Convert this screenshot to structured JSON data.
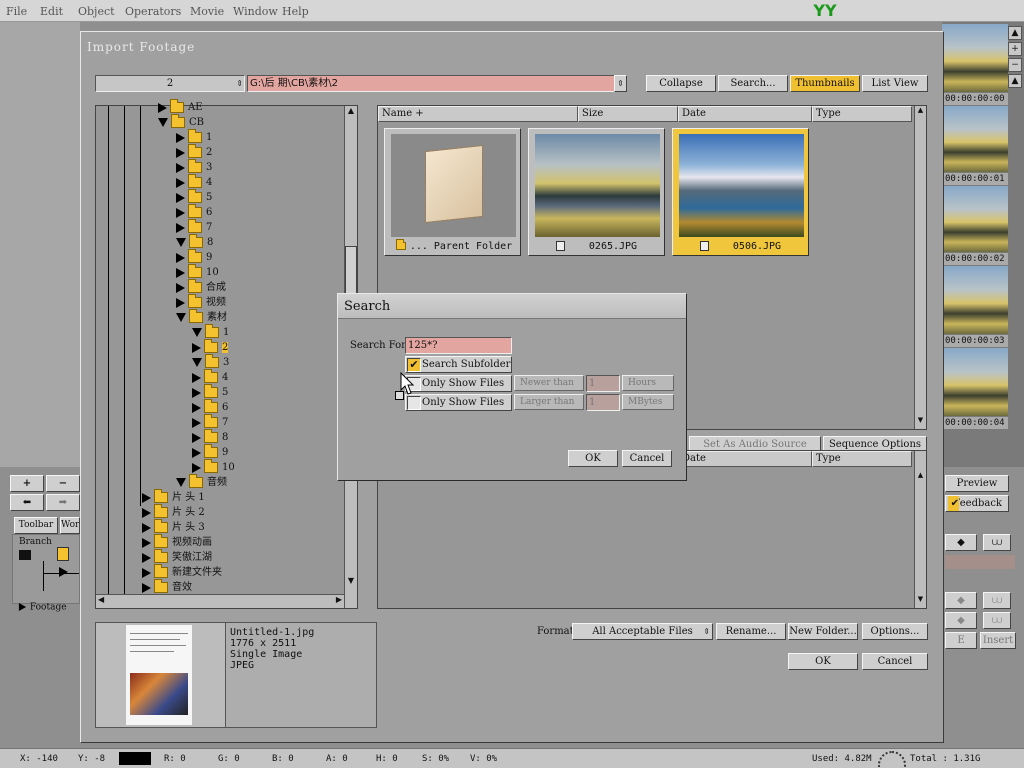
{
  "menubar": [
    "File",
    "Edit",
    "Object",
    "Operators",
    "Movie",
    "Window",
    "Help"
  ],
  "logo_text": "YY",
  "timecodes": [
    "00:00:00:00",
    "00:00:00:01",
    "00:00:00:02",
    "00:00:00:03",
    "00:00:00:04"
  ],
  "right_buttons": [
    "Preview",
    "Feedback"
  ],
  "left_panel": {
    "plus": "+",
    "minus": "−",
    "tab_toolbar": "Toolbar",
    "tab_wo": "Wor",
    "branch": "Branch",
    "footage": "Footage"
  },
  "dialog": {
    "title": "Import Footage",
    "folder_select": "2",
    "path": "G:\\后 期\\CB\\素材\\2",
    "buttons": {
      "collapse": "Collapse",
      "search": "Search...",
      "thumbnails": "Thumbnails",
      "list_view": "List View"
    },
    "columns": [
      "Name +",
      "Size",
      "Date",
      "Type"
    ],
    "thumbs": [
      {
        "caption": "... Parent Folder"
      },
      {
        "caption": "0265.JPG"
      },
      {
        "caption": "0506.JPG"
      }
    ],
    "seq_tabs": {
      "audio": "Set As Audio Source",
      "seq": "Sequence Options"
    },
    "seq_columns": [
      "Date",
      "Type"
    ],
    "format_label": "Format",
    "format_value": "All Acceptable Files",
    "rename": "Rename...",
    "new_folder": "New Folder...",
    "options": "Options...",
    "ok": "OK",
    "cancel": "Cancel",
    "info": {
      "name": "Untitled-1.jpg",
      "dims": "1776 x 2511",
      "kind": "Single Image",
      "format": "JPEG"
    }
  },
  "tree": [
    {
      "label": "AE",
      "depth": 0,
      "open": false
    },
    {
      "label": "CB",
      "depth": 0,
      "open": true
    },
    {
      "label": "1",
      "depth": 1
    },
    {
      "label": "2",
      "depth": 1
    },
    {
      "label": "3",
      "depth": 1
    },
    {
      "label": "4",
      "depth": 1
    },
    {
      "label": "5",
      "depth": 1
    },
    {
      "label": "6",
      "depth": 1
    },
    {
      "label": "7",
      "depth": 1
    },
    {
      "label": "8",
      "depth": 1,
      "open": true
    },
    {
      "label": "9",
      "depth": 1
    },
    {
      "label": "10",
      "depth": 1
    },
    {
      "label": "合成",
      "depth": 1
    },
    {
      "label": "视频",
      "depth": 1
    },
    {
      "label": "素材",
      "depth": 1,
      "open": true
    },
    {
      "label": "1",
      "depth": 2,
      "open": true
    },
    {
      "label": "2",
      "depth": 2,
      "selected": true
    },
    {
      "label": "3",
      "depth": 2,
      "open": true
    },
    {
      "label": "4",
      "depth": 2
    },
    {
      "label": "5",
      "depth": 2
    },
    {
      "label": "6",
      "depth": 2
    },
    {
      "label": "7",
      "depth": 2
    },
    {
      "label": "8",
      "depth": 2
    },
    {
      "label": "9",
      "depth": 2
    },
    {
      "label": "10",
      "depth": 2
    },
    {
      "label": "音频",
      "depth": 1,
      "open": true
    },
    {
      "label": "片 头 1",
      "depth": -1
    },
    {
      "label": "片 头 2",
      "depth": -1
    },
    {
      "label": "片 头 3",
      "depth": -1
    },
    {
      "label": "视频动画",
      "depth": -1
    },
    {
      "label": "笑傲江湖",
      "depth": -1
    },
    {
      "label": "新建文件夹",
      "depth": -1
    },
    {
      "label": "音效",
      "depth": -1
    }
  ],
  "search": {
    "title": "Search",
    "search_for_label": "Search For",
    "search_for_value": "125*?",
    "subfolders": "Search Subfolders",
    "only_show_1": "Only Show Files",
    "only_show_2": "Only Show Files",
    "newer_than": "Newer than",
    "newer_value": "1",
    "hours": "Hours",
    "larger_than": "Larger than",
    "larger_value": "1",
    "mbytes": "MBytes",
    "ok": "OK",
    "cancel": "Cancel"
  },
  "statusbar": {
    "x": "X: -140",
    "y": "Y: -8",
    "r": "R: 0",
    "g": "G: 0",
    "b": "B: 0",
    "a": "A: 0",
    "h": "H: 0",
    "s": "S: 0%",
    "v": "V: 0%",
    "used": "Used: 4.82M",
    "total": "Total : 1.31G"
  },
  "right_misc": {
    "insert": "Insert",
    "e": "E"
  }
}
